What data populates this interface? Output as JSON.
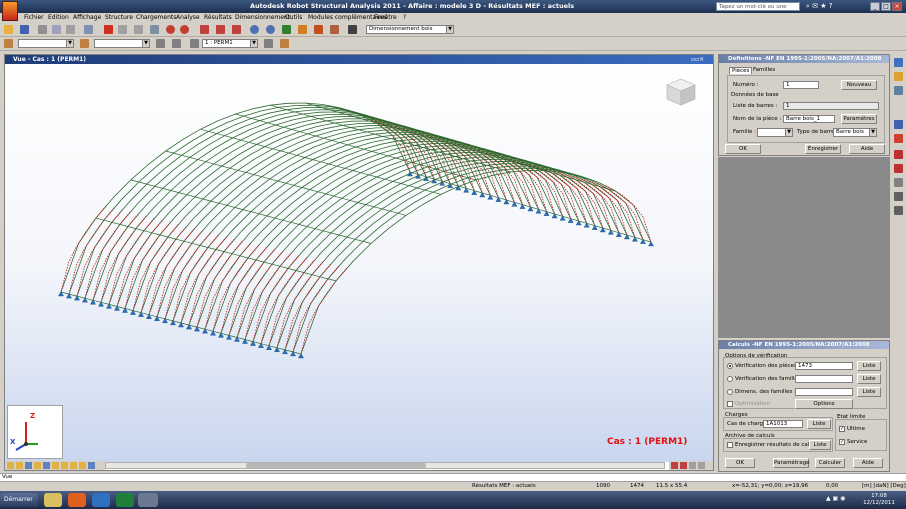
{
  "title": "Autodesk Robot Structural Analysis 2011 - Affaire : modele 3 D - Résultats MEF : actuels",
  "search_placeholder": "Tapez un mot-clé ou une expression",
  "menu": [
    "Fichier",
    "Edition",
    "Affichage",
    "Structure",
    "Chargements",
    "Analyse",
    "Résultats",
    "Dimensionnement",
    "Outils",
    "Modules complémentaires",
    "Fenêtre",
    "?"
  ],
  "toolbar": {
    "module_combo": "Dimensionnement bois",
    "load_case_combo": "1 : PERM1"
  },
  "viewport": {
    "title": "Vue - Cas : 1 (PERM1)",
    "case_label": "Cas : 1 (PERM1)",
    "axis_z": "Z",
    "axis_x": "X"
  },
  "definitions_panel": {
    "title": "Définitions -NF EN 1995-1:2005/NA:2007/A1:2008",
    "tabs": [
      "Pièces",
      "Familles"
    ],
    "numero_label": "Numéro :",
    "numero_value": "1",
    "nouveau": "Nouveau",
    "donnees_label": "Données de base",
    "liste_label": "Liste de barres :",
    "liste_value": "1",
    "nom_label": "Nom de la pièce :",
    "nom_value": "Barre bois_1",
    "parametres": "Paramètres",
    "famille_label": "Famille :",
    "type_label": "Type de barre :",
    "type_value": "Barre bois",
    "ok": "OK",
    "enregistrer": "Enregistrer",
    "aide": "Aide"
  },
  "calc_panel": {
    "title": "Calculs -NF EN 1995-1:2005/NA:2007/A1:2008",
    "options_label": "Options de vérification",
    "verif_pieces": "Vérification des pièces :",
    "verif_pieces_value": "1473",
    "verif_familles": "Vérification des familles :",
    "dimens_familles": "Dimens. des familles :",
    "optimisation": "Optimisation",
    "options": "Options",
    "liste": "Liste",
    "charges_label": "Charges",
    "cas_label": "Cas de charge :",
    "cas_value": "1A1013",
    "archive_label": "Archive de calculs",
    "enregistrer_res": "Enregistrer résultats de calculs",
    "etat_label": "Etat limite",
    "ultime": "Ultime",
    "service": "Service",
    "ok": "OK",
    "parametrage": "Paramétrage",
    "calculer": "Calculer",
    "aide": "Aide"
  },
  "command_line": "Vue",
  "status": {
    "results": "Résultats MEF : actuels",
    "v1": "1090",
    "v2": "1474",
    "section": "11.5 x 55.4",
    "coords": "x=-52,31; y=0,00; z=19,96",
    "angle": "0,00",
    "units": "[m] [daN] [Deg]"
  },
  "taskbar": {
    "start": "Démarrer",
    "time": "17:08",
    "date": "12/12/2011"
  },
  "icons": [
    "search-icon",
    "minimize-icon",
    "maximize-icon",
    "close-icon",
    "open-icon",
    "save-icon",
    "print-icon",
    "undo-icon",
    "redo-icon",
    "zoom-icon",
    "view-cube-icon"
  ]
}
